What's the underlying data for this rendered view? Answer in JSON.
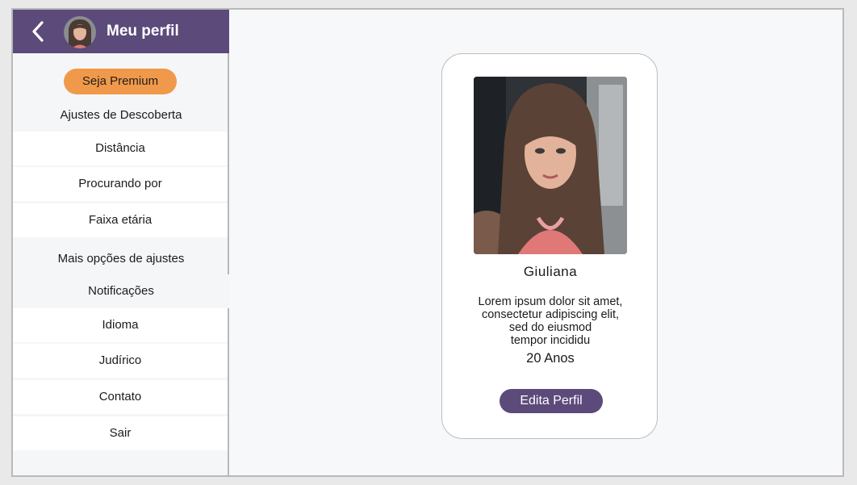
{
  "header": {
    "title": "Meu perfil",
    "back_icon": "chevron-left-icon",
    "avatar": "user-avatar"
  },
  "sidebar": {
    "premium_label": "Seja Premium",
    "discovery_label": "Ajustes de Descoberta",
    "discovery_items": [
      {
        "label": "Distância"
      },
      {
        "label": "Procurando por"
      },
      {
        "label": "Faixa etária"
      }
    ],
    "more_label": "Mais opções de ajustes",
    "notifications_label": "Notificações",
    "more_items": [
      {
        "label": "Idioma"
      },
      {
        "label": "Judírico"
      },
      {
        "label": "Contato"
      },
      {
        "label": "Sair"
      }
    ]
  },
  "profile": {
    "name": "Giuliana",
    "bio_lines": [
      "Lorem ipsum dolor sit amet,",
      "consectetur adipiscing elit,",
      "sed do eiusmod",
      "tempor incididu"
    ],
    "age": "20 Anos",
    "edit_label": "Edita Perfil"
  },
  "colors": {
    "accent": "#5b4a7a",
    "premium": "#f1994a",
    "background": "#f7f8fa",
    "card": "#ffffff"
  }
}
